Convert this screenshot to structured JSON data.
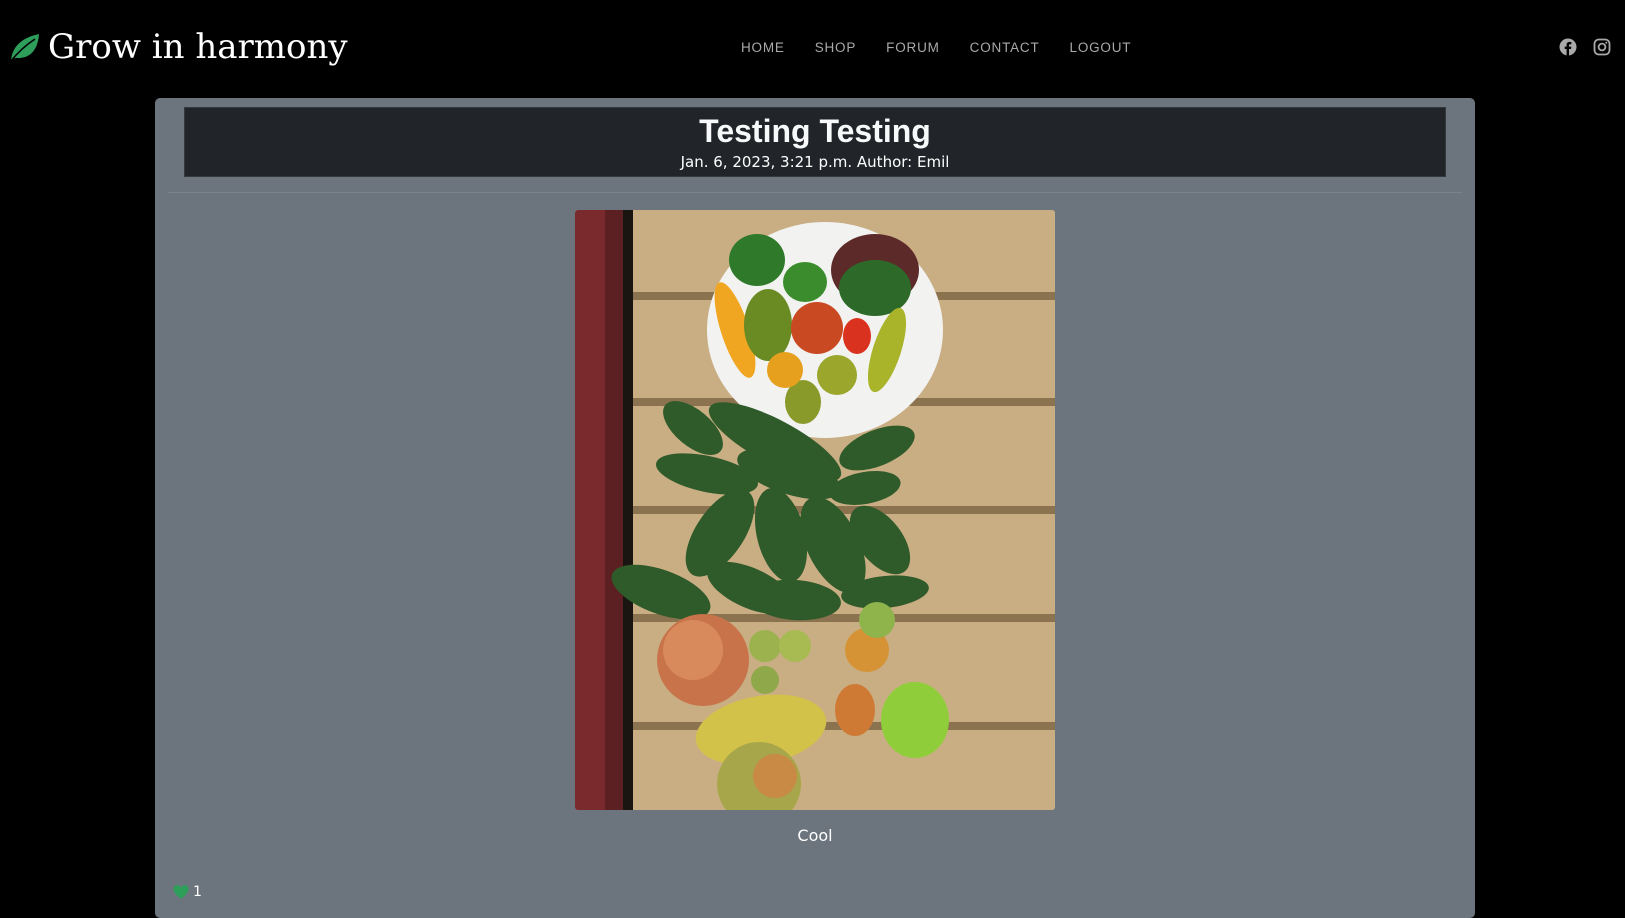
{
  "brand": {
    "name": "Grow in harmony",
    "icon": "leaf-icon",
    "icon_color": "#2e9e5b"
  },
  "nav": {
    "items": [
      {
        "label": "HOME"
      },
      {
        "label": "SHOP"
      },
      {
        "label": "FORUM"
      },
      {
        "label": "CONTACT"
      },
      {
        "label": "LOGOUT"
      }
    ]
  },
  "social": {
    "icons": [
      "facebook-icon",
      "instagram-icon"
    ],
    "color": "#a9a9a9"
  },
  "post": {
    "title": "Testing Testing",
    "meta": "Jan. 6, 2023, 3:21 p.m. Author: Emil",
    "image_subject": "vegetables-on-wooden-deck",
    "caption": "Cool",
    "likes": "1"
  },
  "colors": {
    "page_bg": "#000000",
    "card_bg": "#6c757d",
    "header_bg": "#212529",
    "accent": "#2e9e5b"
  }
}
